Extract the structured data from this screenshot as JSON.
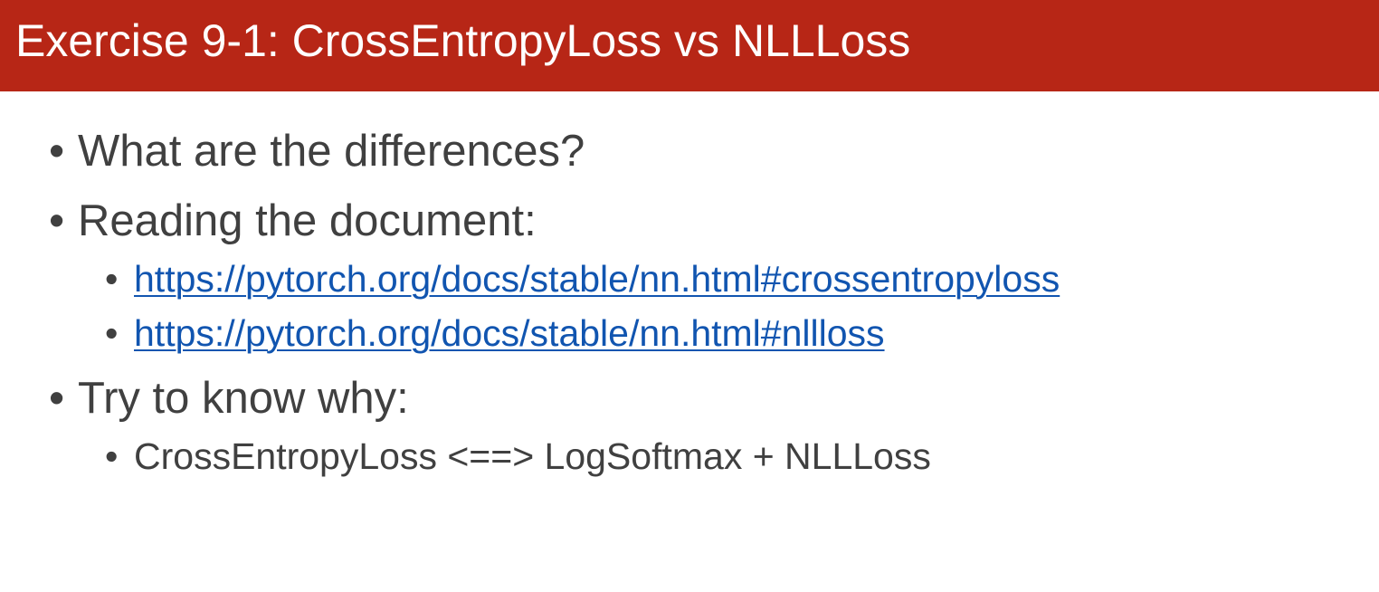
{
  "slide": {
    "title": "Exercise 9-1: CrossEntropyLoss vs NLLLoss",
    "bullet_char": "•",
    "items": [
      {
        "text": "What are the differences?"
      },
      {
        "text": "Reading the document:",
        "subitems": [
          "https://pytorch.org/docs/stable/nn.html#crossentropyloss",
          "https://pytorch.org/docs/stable/nn.html#nllloss"
        ]
      },
      {
        "text": "Try to know why:",
        "subitems": [
          "CrossEntropyLoss <==> LogSoftmax + NLLLoss"
        ]
      }
    ]
  }
}
